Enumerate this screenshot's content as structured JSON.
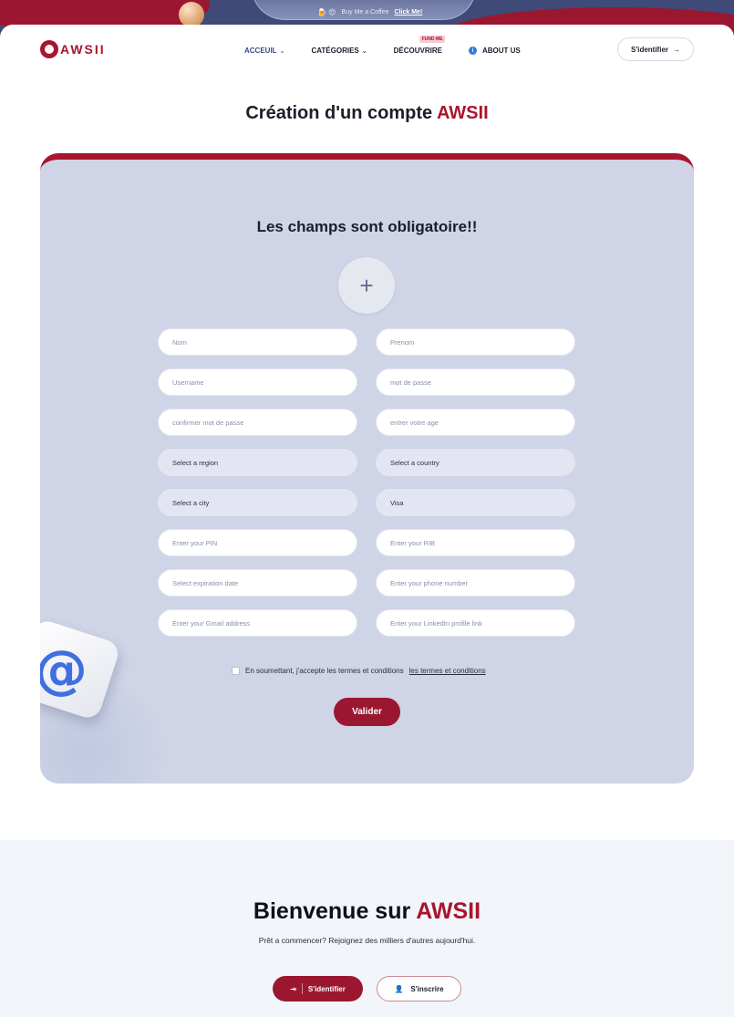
{
  "banner": {
    "coffee_text": "Buy Me a Coffee",
    "coffee_link": "Click Me!",
    "emoji": "🍺 😍"
  },
  "header": {
    "logo_text": "AWSII",
    "nav": [
      {
        "label": "ACCEUIL",
        "has_dropdown": true,
        "active": true
      },
      {
        "label": "CATÉGORIES",
        "has_dropdown": true,
        "active": false
      },
      {
        "label": "DÉCOUVRIRE",
        "has_dropdown": false,
        "active": false,
        "badge": "FUND ME"
      },
      {
        "label": "ABOUT US",
        "has_dropdown": false,
        "active": false,
        "icon": "info-icon"
      }
    ],
    "login_label": "S'identifier"
  },
  "page": {
    "title_prefix": "Création d'un compte ",
    "title_accent": "AWSII"
  },
  "form": {
    "heading": "Les champs sont obligatoire!!",
    "fields": {
      "nom": "Nom",
      "prenom": "Prenom",
      "username": "Username",
      "password": "mot de passe",
      "confirm": "confirmer mot de passe",
      "age": "entrer votre age",
      "region": "Select a region",
      "country": "Select a country",
      "city": "Select a city",
      "card_type": "Visa",
      "pin": "Enter your PIN",
      "rib": "Enter your RIB",
      "expiration": "Select expiration date",
      "phone": "Enter your phone number",
      "gmail": "Enter your Gmail address",
      "linkedin": "Enter your LinkedIn profile link"
    },
    "terms_text": "En soumettant, j'accepte les termes et conditions",
    "terms_link": "les termes et conditions",
    "submit_label": "Valider"
  },
  "welcome": {
    "title_prefix": "Bienvenue sur ",
    "title_accent": "AWSII",
    "subtitle": "Prêt a commencer? Rejoignez des milliers d'autres aujourd'hui.",
    "login_label": "S'identifier",
    "signup_label": "S'inscrire"
  },
  "colors": {
    "brand": "#9b1730",
    "nav_active": "#3b4c85",
    "card_bg": "#cfd4e6"
  }
}
